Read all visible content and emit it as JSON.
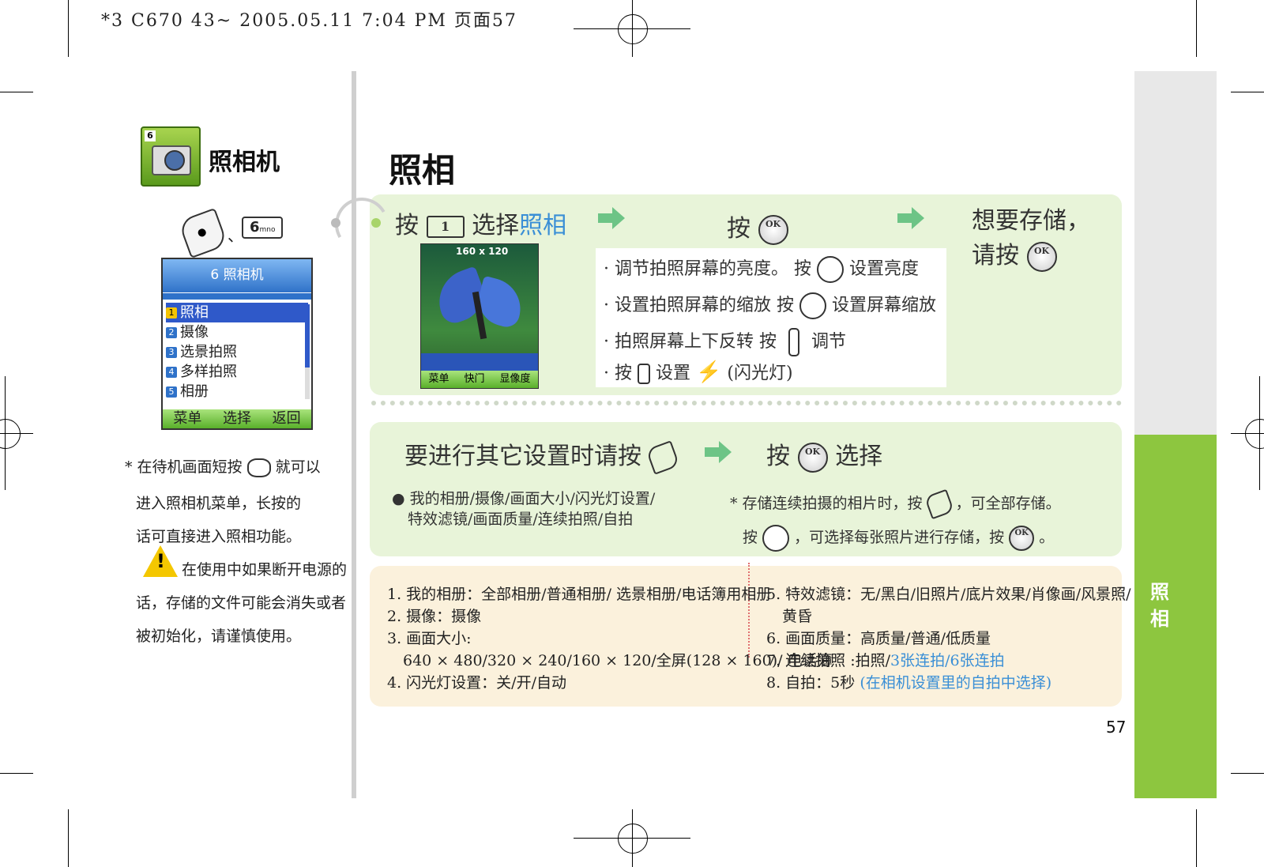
{
  "header": {
    "print_info": "*3 C670 43~ 2005.05.11 7:04 PM 页面57"
  },
  "side_tab": {
    "label": "照相"
  },
  "left": {
    "app_title": "照相机",
    "key_6": "6",
    "key_6_sub": "mno",
    "separator": "、",
    "screen": {
      "title": "6 照相机",
      "items": [
        {
          "num": "1",
          "label": "照相"
        },
        {
          "num": "2",
          "label": "摄像"
        },
        {
          "num": "3",
          "label": "选景拍照"
        },
        {
          "num": "4",
          "label": "多样拍照"
        },
        {
          "num": "5",
          "label": "相册"
        }
      ],
      "softkeys": [
        "菜单",
        "选择",
        "返回"
      ]
    },
    "note_line1a": "* 在待机画面短按",
    "note_line1b": "就可以",
    "note_line2": "进入照相机菜单，长按的",
    "note_line3": "话可直接进入照相功能。",
    "warn_line1": "在使用中如果断开电源的",
    "warn_line2": "话，存储的文件可能会消失或者",
    "warn_line3": "被初始化，请谨慎使用。"
  },
  "main": {
    "title": "照相",
    "step1_press": "按",
    "step1_key": "1",
    "step1_select": "选择",
    "step1_select_blue": "照相",
    "step2_press": "按",
    "ok": "OK",
    "step3_line1": "想要存储，",
    "step3_line2": "请按",
    "photo_res": "160 x 120",
    "photo_softkeys": [
      "菜单",
      "快门",
      "显像度"
    ],
    "bullets": [
      {
        "a": "· 调节拍照屏幕的亮度。 按",
        "b": "设置亮度"
      },
      {
        "a": "· 设置拍照屏幕的缩放 按",
        "b": "设置屏幕缩放"
      },
      {
        "a": "· 拍照屏幕上下反转 按",
        "b": "调节"
      },
      {
        "a": "· 按",
        "b": "设置",
        "c": "(闪光灯)"
      }
    ],
    "sec2_text": "要进行其它设置时请按",
    "sec2_press": "按",
    "sec2_select": "选择",
    "sec2_options_1": "我的相册/摄像/画面大小/闪光灯设置/",
    "sec2_options_2": "特效滤镜/画面质量/连续拍照/自拍",
    "sec2_note_1a": "* 存储连续拍摄的相片时，按",
    "sec2_note_1b": "，可全部存储。",
    "sec2_note_2a": "按",
    "sec2_note_2b": "，可选择每张照片进行存储，按",
    "sec2_note_2c": "。",
    "list_left": [
      "1. 我的相册：全部相册/普通相册/ 选景相册/电话簿用相册",
      "2. 摄像：摄像",
      "3. 画面大小:",
      "640 × 480/320 × 240/160 × 120/全屏(128 × 160)/ 电话簿",
      "4. 闪光灯设置：关/开/自动"
    ],
    "list_right_5a": "5. 特效滤镜：无/黑白/旧照片/底片效果/肖像画/风景照/",
    "list_right_5b": "黄昏",
    "list_right_6": "6. 画面质量：高质量/普通/低质量",
    "list_right_7a": "7. 连续拍照 :拍照/",
    "list_right_7b": "3张连拍/6张连拍",
    "list_right_8a": "8. 自拍：5秒",
    "list_right_8b": "(在相机设置里的自拍中选择)",
    "page_number": "57"
  },
  "colors": {
    "green_tab": "#8dc63f",
    "panel_green": "#e8f4d9",
    "panel_cream": "#fbf1dc",
    "accent_blue": "#3a8fd6",
    "arrow_green": "#6dc486"
  }
}
